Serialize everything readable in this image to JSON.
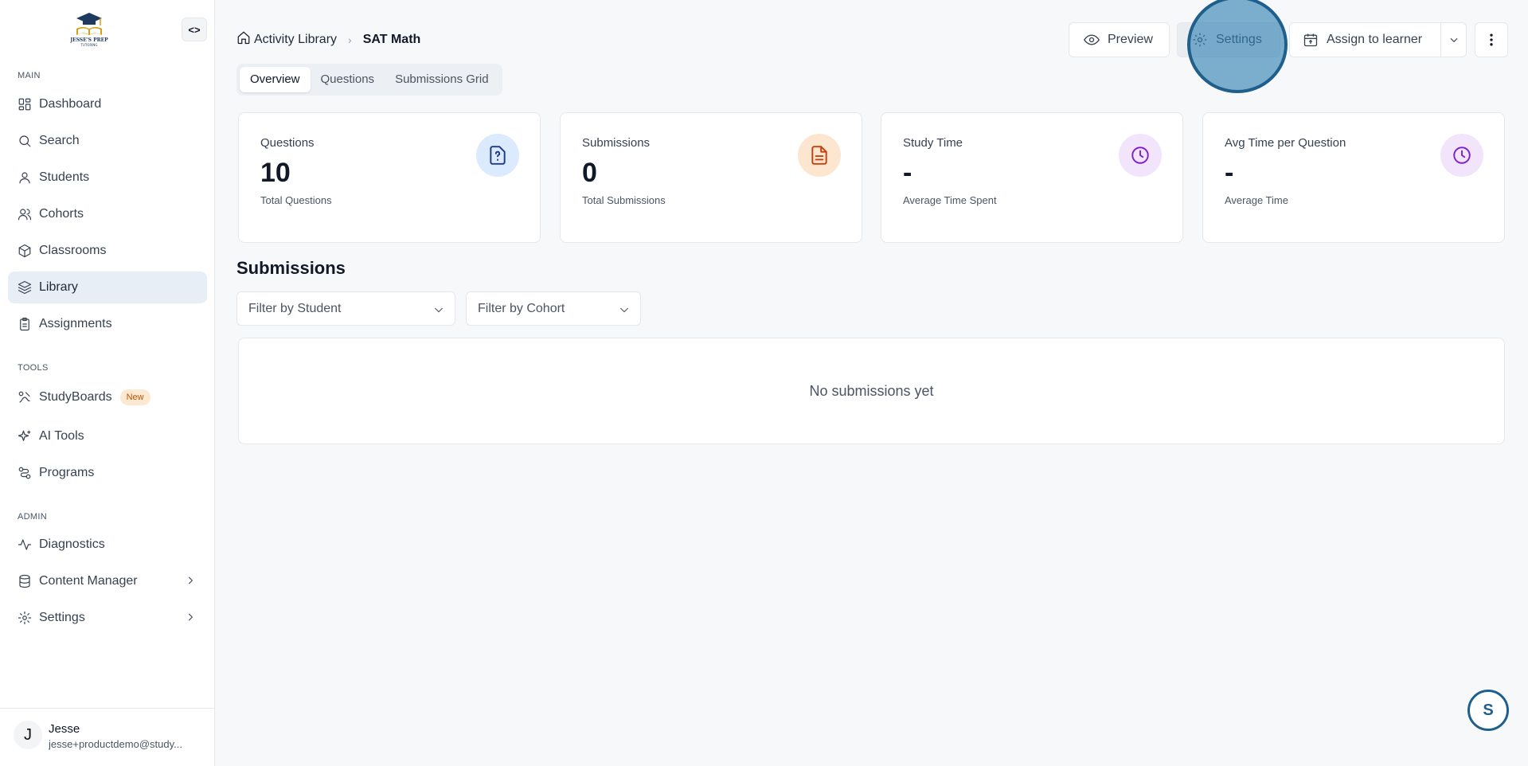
{
  "sidebar": {
    "logo_text": "JESSE'S PREP TUTORING",
    "collapse_icon": "code-brackets-icon",
    "sections": {
      "main": "MAIN",
      "tools": "TOOLS",
      "admin": "ADMIN"
    },
    "items": {
      "dashboard": "Dashboard",
      "search": "Search",
      "students": "Students",
      "cohorts": "Cohorts",
      "classrooms": "Classrooms",
      "library": "Library",
      "assignments": "Assignments",
      "studyboards": "StudyBoards",
      "studyboards_badge": "New",
      "ai_tools": "AI Tools",
      "programs": "Programs",
      "diagnostics": "Diagnostics",
      "content_manager": "Content Manager",
      "settings": "Settings"
    },
    "active_item": "library",
    "user": {
      "initial": "J",
      "name": "Jesse",
      "email": "jesse+productdemo@study..."
    }
  },
  "header": {
    "breadcrumb": {
      "parent": "Activity Library",
      "current": "SAT Math"
    },
    "buttons": {
      "preview": "Preview",
      "settings": "Settings",
      "assign": "Assign to learner"
    }
  },
  "tabs": [
    "Overview",
    "Questions",
    "Submissions Grid"
  ],
  "active_tab": "Overview",
  "stats": [
    {
      "title": "Questions",
      "value": "10",
      "subtitle": "Total Questions",
      "icon": "question-file-icon",
      "color": "#dbeafe"
    },
    {
      "title": "Submissions",
      "value": "0",
      "subtitle": "Total Submissions",
      "icon": "document-icon",
      "color": "#fde6cf"
    },
    {
      "title": "Study Time",
      "value": "-",
      "subtitle": "Average Time Spent",
      "icon": "clock-icon",
      "color": "#f2e5fb"
    },
    {
      "title": "Avg Time per Question",
      "value": "-",
      "subtitle": "Average Time",
      "icon": "clock-icon",
      "color": "#f2e5fb"
    }
  ],
  "submissions": {
    "heading": "Submissions",
    "filter_student": "Filter by Student",
    "filter_cohort": "Filter by Cohort",
    "empty_text": "No submissions yet"
  },
  "help_widget": {
    "label": "S"
  },
  "colors": {
    "active_nav_bg": "#e8eef5",
    "accent": "#1f5f8b",
    "badge_bg": "#fde8d2"
  }
}
